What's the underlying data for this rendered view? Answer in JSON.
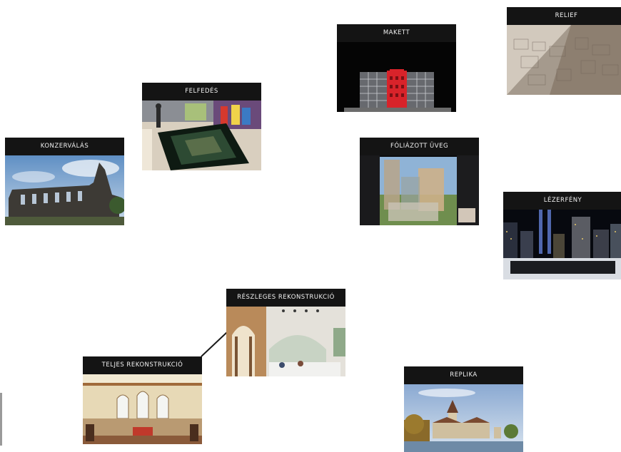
{
  "cards": {
    "konzervalas": "KONZERVÁLÁS",
    "felfedes": "FELFEDÉS",
    "makett": "MAKETT",
    "relief": "RELIEF",
    "foliazott_uveg": "FÓLIÁZOTT ÜVEG",
    "lezerfeny": "LÉZERFÉNY",
    "reszleges_rekonstrukcio": "RÉSZLEGES REKONSTRUKCIÓ",
    "teljes_rekonstrukcio": "TELJES REKONSTRUKCIÓ",
    "replika": "REPLIKA"
  },
  "colors": {
    "label_bg": "#141414",
    "label_text": "#f2f2f2",
    "connector": "#1a1a1a"
  }
}
